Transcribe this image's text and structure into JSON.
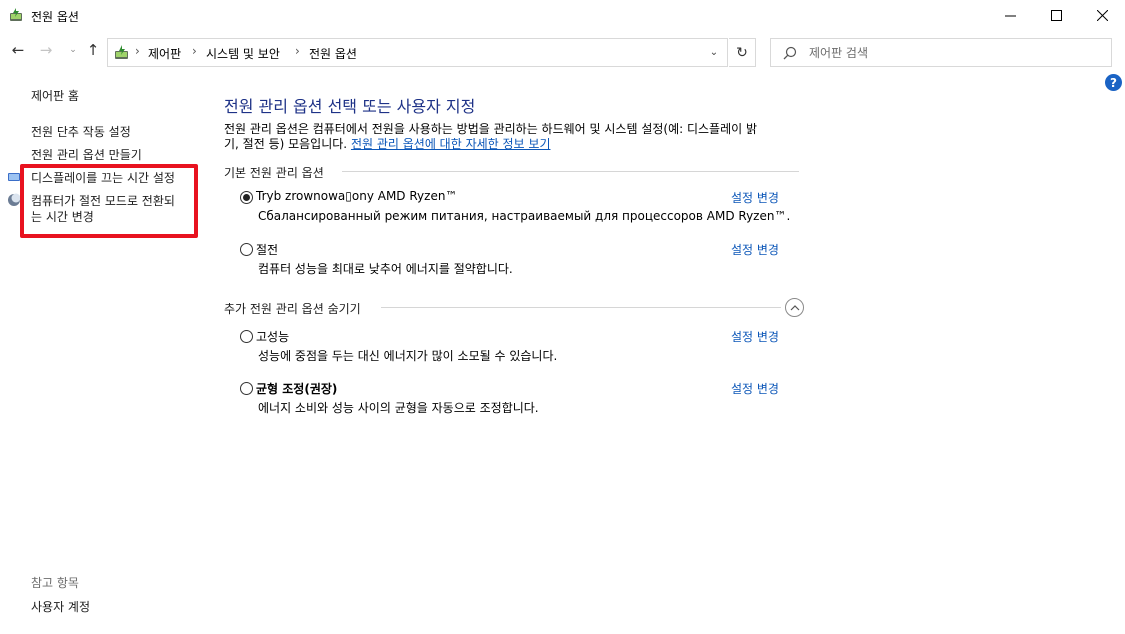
{
  "window": {
    "title": "전원 옵션",
    "minimize_glyph": "—",
    "maximize_glyph": "☐",
    "close_glyph": "✕"
  },
  "nav": {
    "back_glyph": "←",
    "forward_glyph": "→",
    "recent_glyph": "⌄",
    "up_glyph": "↑",
    "refresh_glyph": "↻",
    "dropdown_glyph": "⌄"
  },
  "address": {
    "separator": "›",
    "crumbs": [
      "제어판",
      "시스템 및 보안",
      "전원 옵션"
    ]
  },
  "search": {
    "placeholder": "제어판 검색"
  },
  "help": {
    "glyph": "?"
  },
  "sidebar": {
    "home": "제어판 홈",
    "links": [
      "전원 단추 작동 설정",
      "전원 관리 옵션 만들기",
      "디스플레이를 끄는 시간 설정",
      "컴퓨터가 절전 모드로 전환되",
      "는 시간 변경"
    ],
    "see_also_heading": "참고 항목",
    "see_also_links": [
      "사용자 계정"
    ]
  },
  "main": {
    "title": "전원 관리 옵션 선택 또는 사용자 지정",
    "description_line1": "전원 관리 옵션은 컴퓨터에서 전원을 사용하는 방법을 관리하는 하드웨어 및 시스템 설정(예: 디스플레이 밝",
    "description_line2": "기, 절전 등) 모음입니다.",
    "description_link": "전원 관리 옵션에 대한 자세한 정보 보기",
    "preferred_heading": "기본 전원 관리 옵션",
    "hidden_heading": "추가 전원 관리 옵션 숨기기",
    "change_label": "설정 변경",
    "collapse_glyph": "⌃",
    "preferred_plans": [
      {
        "name": "Tryb zrownowa▯ony AMD Ryzen™",
        "description": "Сбалансированный режим питания, настраиваемый для процессоров AMD Ryzen™.",
        "selected": true
      },
      {
        "name": "절전",
        "description": "컴퓨터 성능을 최대로 낮추어 에너지를 절약합니다.",
        "selected": false
      }
    ],
    "hidden_plans": [
      {
        "name": "고성능",
        "description": "성능에 중점을 두는 대신 에너지가 많이 소모될 수 있습니다.",
        "selected": false
      },
      {
        "name": "균형 조정(권장)",
        "description": "에너지 소비와 성능 사이의 균형을 자동으로 조정합니다.",
        "selected": false
      }
    ]
  },
  "colors": {
    "title_blue": "#1e3287",
    "link_blue": "#0b56b8",
    "highlight_red": "#e8121f"
  }
}
